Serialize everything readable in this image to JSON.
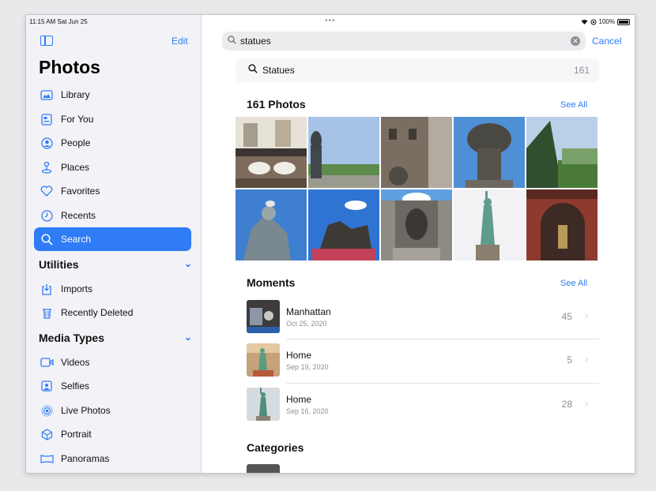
{
  "status": {
    "time": "11:15 AM  Sat Jun 25",
    "battery": "100%"
  },
  "sidebar": {
    "edit_label": "Edit",
    "title": "Photos",
    "items": [
      {
        "label": "Library",
        "icon": "library-icon"
      },
      {
        "label": "For You",
        "icon": "for-you-icon"
      },
      {
        "label": "People",
        "icon": "people-icon"
      },
      {
        "label": "Places",
        "icon": "places-icon"
      },
      {
        "label": "Favorites",
        "icon": "heart-icon"
      },
      {
        "label": "Recents",
        "icon": "clock-icon"
      },
      {
        "label": "Search",
        "icon": "search-icon",
        "selected": true
      }
    ],
    "utilities": {
      "title": "Utilities",
      "items": [
        {
          "label": "Imports",
          "icon": "import-icon"
        },
        {
          "label": "Recently Deleted",
          "icon": "trash-icon"
        }
      ]
    },
    "media_types": {
      "title": "Media Types",
      "items": [
        {
          "label": "Videos",
          "icon": "video-icon"
        },
        {
          "label": "Selfies",
          "icon": "selfie-icon"
        },
        {
          "label": "Live Photos",
          "icon": "live-photo-icon"
        },
        {
          "label": "Portrait",
          "icon": "portrait-icon"
        },
        {
          "label": "Panoramas",
          "icon": "panorama-icon"
        }
      ]
    }
  },
  "search": {
    "value": "statues",
    "cancel_label": "Cancel",
    "suggestion": {
      "label": "Statues",
      "count": "161"
    }
  },
  "photos_section": {
    "title": "161 Photos",
    "see_all": "See All"
  },
  "moments_section": {
    "title": "Moments",
    "see_all": "See All",
    "items": [
      {
        "title": "Manhattan",
        "date": "Oct 25, 2020",
        "count": "45"
      },
      {
        "title": "Home",
        "date": "Sep 19, 2020",
        "count": "5"
      },
      {
        "title": "Home",
        "date": "Sep 16, 2020",
        "count": "28"
      }
    ]
  },
  "categories_section": {
    "title": "Categories"
  },
  "colors": {
    "accent": "#2f7cf6",
    "sidebar_bg": "#f2f2f7",
    "secondary_text": "#8e8e93"
  }
}
